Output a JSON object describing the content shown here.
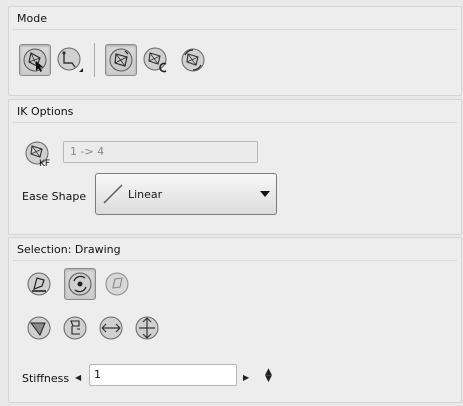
{
  "mode": {
    "title": "Mode",
    "tools": [
      {
        "name": "transform-tool",
        "pressed": true
      },
      {
        "name": "ik-manipulator-tool",
        "pressed": false
      },
      {
        "name": "ik-pose-tool",
        "pressed": true
      },
      {
        "name": "ik-constraint-tool",
        "pressed": false
      },
      {
        "name": "ik-rotate-tool",
        "pressed": false
      }
    ]
  },
  "ik_options": {
    "title": "IK Options",
    "keyframe_range_placeholder": "1 -> 4",
    "ease_shape_label": "Ease Shape",
    "ease_shape_value": "Linear"
  },
  "selection": {
    "title": "Selection: Drawing",
    "stiffness_label": "Stiffness",
    "stiffness_value": "1"
  }
}
